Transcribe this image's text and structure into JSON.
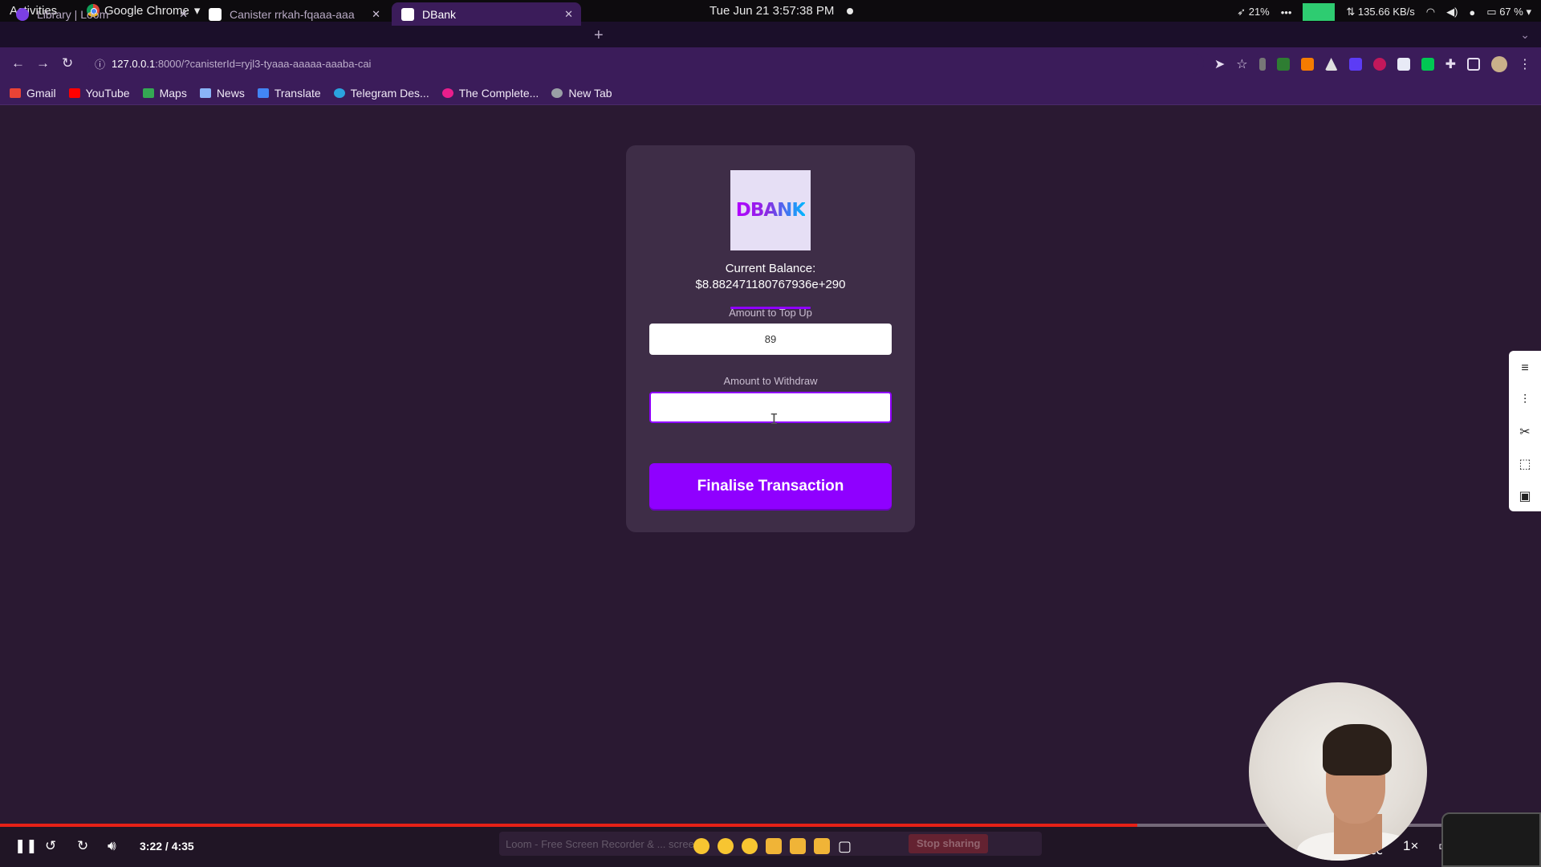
{
  "system_bar": {
    "activities": "Activities",
    "app_name": "Google Chrome",
    "clock": "Tue Jun 21  3:57:38 PM",
    "cpu": "21%",
    "network": "⇅ 135.66 KB/s",
    "battery": "67 %"
  },
  "tabs": [
    {
      "title": "Library | Loom",
      "active": false
    },
    {
      "title": "Canister rrkah-fqaaa-aaa",
      "active": false
    },
    {
      "title": "DBank",
      "active": true
    }
  ],
  "address_bar": {
    "host": "127.0.0.1",
    "path": ":8000/?canisterId=ryjl3-tyaaa-aaaaa-aaaba-cai"
  },
  "bookmarks": [
    {
      "label": "Gmail",
      "color": "#ea4335"
    },
    {
      "label": "YouTube",
      "color": "#ff0000"
    },
    {
      "label": "Maps",
      "color": "#34a853"
    },
    {
      "label": "News",
      "color": "#8ab4f8"
    },
    {
      "label": "Translate",
      "color": "#4285f4"
    },
    {
      "label": "Telegram Des...",
      "color": "#2aa3df"
    },
    {
      "label": "The Complete...",
      "color": "#e91e8c"
    },
    {
      "label": "New Tab",
      "color": "#9aa0a6"
    }
  ],
  "dbank": {
    "logo_text": "DBANK",
    "balance_label": "Current Balance:",
    "balance_value": "$8.882471180767936e+290",
    "topup_label": "Amount to Top Up",
    "topup_value": "89",
    "withdraw_label": "Amount to Withdraw",
    "withdraw_value": "",
    "submit_label": "Finalise Transaction"
  },
  "video_player": {
    "time": "3:22 / 4:35",
    "progress": 0.7382,
    "speed": "1×",
    "loom_banner": "Loom - Free Screen Recorder & ... screen.",
    "stop_sharing": "Stop sharing"
  },
  "colors": {
    "accent": "#8f00ff",
    "page_bg": "#2a1932",
    "card_bg": "#3e2d47",
    "chrome_theme": "#3b1c5a"
  }
}
